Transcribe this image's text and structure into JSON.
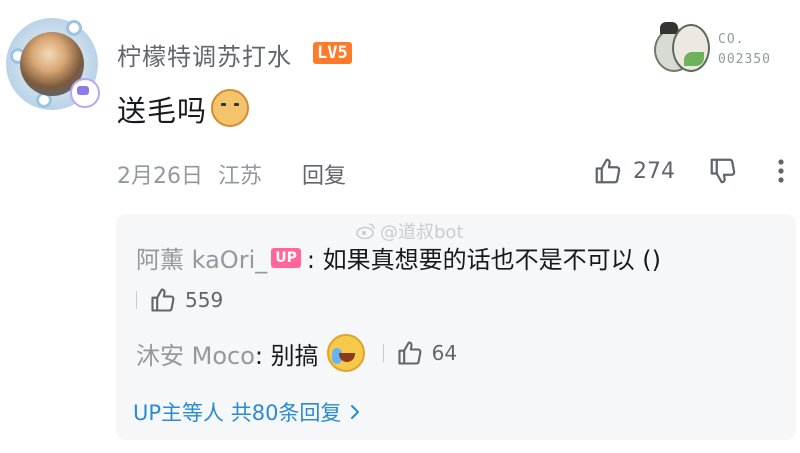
{
  "comment": {
    "username": "柠檬特调苏打水",
    "level_badge": "LV5",
    "fan_medal_label_line1": "CO.",
    "fan_medal_label_line2": "002350",
    "text": "送毛吗",
    "emoji": "dog-face-emoji",
    "date": "2月26日",
    "location": "江苏",
    "reply_label": "回复",
    "like_count": "274"
  },
  "watermark": "@道叔bot",
  "replies": [
    {
      "username": "阿薰 kaOri_",
      "badge": "UP",
      "text": ": 如果真想要的话也不是不可以 ()",
      "like_count": "559"
    },
    {
      "username": "沐安 Moco",
      "text": ": 别搞",
      "emoji": "crying-face-emoji",
      "like_count": "64"
    }
  ],
  "view_more": "UP主等人 共80条回复",
  "colors": {
    "level_badge": "#ff7a29",
    "up_badge": "#ff6699",
    "link_blue": "#2a8bd1",
    "reply_bg": "#f6f7f8"
  }
}
